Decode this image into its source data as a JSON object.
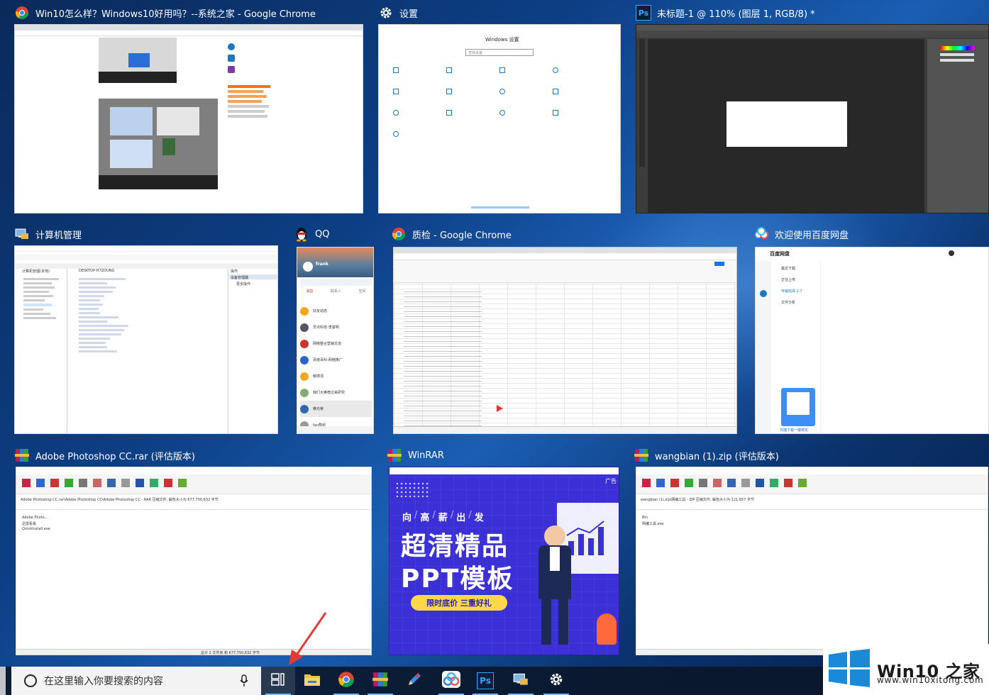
{
  "windows": [
    {
      "id": "chrome1",
      "title": "Win10怎么样？Windows10好用吗？--系统之家 - Google Chrome",
      "icon": "chrome-icon"
    },
    {
      "id": "settings",
      "title": "设置",
      "icon": "gear-icon"
    },
    {
      "id": "ps",
      "title": "未标题-1 @ 110% (图层 1, RGB/8) *",
      "icon": "photoshop-icon"
    },
    {
      "id": "compmgmt",
      "title": "计算机管理",
      "icon": "computer-management-icon"
    },
    {
      "id": "qq",
      "title": "QQ",
      "icon": "qq-penguin-icon"
    },
    {
      "id": "chrome2",
      "title": "质检 - Google Chrome",
      "icon": "chrome-icon"
    },
    {
      "id": "baidu",
      "title": "欢迎使用百度网盘",
      "icon": "baidu-netdisk-icon"
    },
    {
      "id": "rar1",
      "title": "Adobe Photoshop CC.rar (评估版本)",
      "icon": "winrar-icon"
    },
    {
      "id": "winrar",
      "title": "WinRAR",
      "icon": "winrar-icon"
    },
    {
      "id": "rar2",
      "title": "wangbian (1).zip (评估版本)",
      "icon": "winrar-icon"
    }
  ],
  "settings_thumb": {
    "heading": "Windows 设置",
    "search_placeholder": "查找设置"
  },
  "qq_thumb": {
    "user": "frank",
    "tabs": [
      "消息",
      "联系人",
      "空间"
    ],
    "items": [
      "好友动态",
      "早点科技-李富明",
      "网络整合营销交流",
      "百度百科-网络推广",
      "敏感词",
      "我们大推荐过来研究",
      "推光荣",
      "fan群组"
    ]
  },
  "baidu_thumb": {
    "brand": "百度网盘",
    "menu": [
      "最近下载",
      "正在上传",
      "传输完成 2.7",
      "文件分析"
    ],
    "footer": "扫描下载一键绑定"
  },
  "compmgmt_thumb": {
    "root": "计算机管理(本地)",
    "device": "DESKTOP-H7ZOUNG",
    "panel": "操作",
    "panel_item": "设备管理器",
    "panel_item2": "更多操作"
  },
  "ad": {
    "tags": [
      "向",
      "高",
      "薪",
      "出",
      "发"
    ],
    "line1": "超清精品",
    "line2": "PPT模板",
    "cta": "限时底价  三重好礼",
    "corner": "广告"
  },
  "rar1_thumb": {
    "path": "Adobe Photoshop CC.rar\\Adobe Photoshop CC\\Adobe Photoshop CC - RAR 压缩文件, 解包大小为 677,750,632 字节",
    "files": [
      "Adobe Photo...",
      "迅雷看看",
      "QuickInstall.exe"
    ],
    "status": "总计 2 文件夹 和 677,750,632 字节"
  },
  "rar2_thumb": {
    "path": "wangbian (1).zip\\网编工具 - ZIP 压缩文件, 解包大小为 121,657 字节",
    "files": [
      "Bin",
      "网编工具.exe"
    ]
  },
  "taskbar": {
    "search_placeholder": "在这里输入你要搜索的内容",
    "items": [
      "task-view",
      "file-explorer",
      "chrome",
      "winrar",
      "pen-tool",
      "baidu-netdisk",
      "photoshop",
      "computer-management",
      "settings"
    ]
  },
  "brand": {
    "name": "Win10 之家",
    "url": "www.win10xitong.com"
  },
  "colors": {
    "accent": "#1a78c2",
    "ad_bg": "#3b2fd6",
    "ad_yellow": "#ffd84a"
  }
}
